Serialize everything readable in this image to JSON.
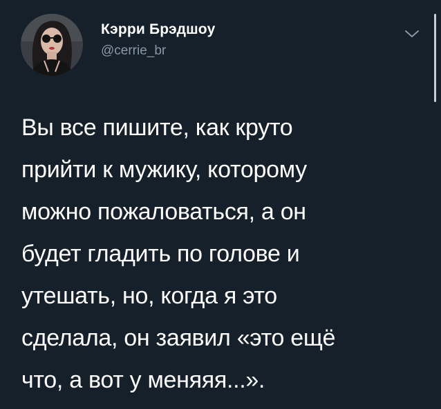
{
  "author": {
    "display_name": "Кэрри Брэдшоу",
    "handle": "@cerrie_br"
  },
  "icons": {
    "menu": "chevron-down-icon",
    "avatar": "profile-photo"
  },
  "tweet": {
    "lines": [
      "Вы все пишите, как круто",
      "прийти к мужику, которому",
      "можно пожаловаться, а он",
      "будет гладить по голове и",
      "утешать, но, когда я это",
      "сделала, он заявил «это ещё",
      "что, а вот у меняяя...»."
    ]
  },
  "colors": {
    "background": "#15202b",
    "text": "#ffffff",
    "secondary": "#8899a6"
  }
}
